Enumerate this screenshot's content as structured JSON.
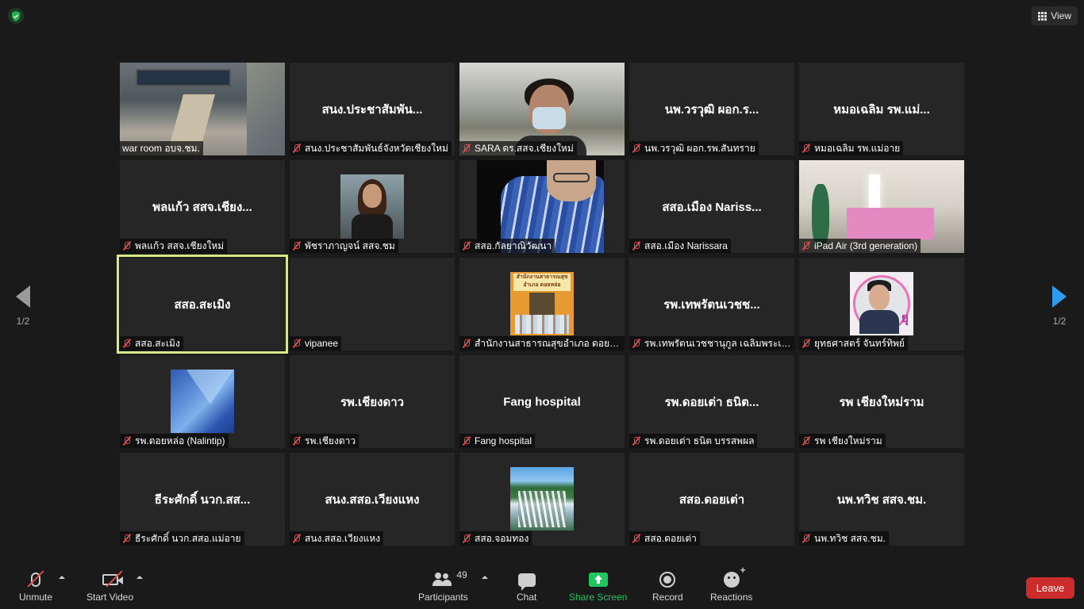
{
  "top": {
    "view_label": "View"
  },
  "pagination": {
    "left_page": "1/2",
    "right_page": "1/2"
  },
  "tiles": [
    {
      "big": "",
      "label": "war room อบจ.ชม."
    },
    {
      "big": "สนง.ประชาสัมพัน...",
      "label": "สนง.ประชาสัมพันธ์จังหวัดเชียงใหม่"
    },
    {
      "big": "",
      "label": "SARA ดร.สสจ.เชียงใหม่"
    },
    {
      "big": "นพ.วรวุฒิ ผอก.ร...",
      "label": "นพ.วรวุฒิ ผอก.รพ.สันทราย"
    },
    {
      "big": "หมอเฉลิม รพ.แม่...",
      "label": "หมอเฉลิม รพ.แม่อาย"
    },
    {
      "big": "พลแก้ว สสจ.เชียง...",
      "label": "พลแก้ว สสจ.เชียงใหม่"
    },
    {
      "big": "",
      "label": "พัชราภาญจน์ สสจ.ชม"
    },
    {
      "big": "",
      "label": "สสอ.กัลยาณิวัฒนา"
    },
    {
      "big": "สสอ.เมือง Nariss...",
      "label": "สสอ.เมือง Narissara"
    },
    {
      "big": "",
      "label": "iPad Air (3rd generation)"
    },
    {
      "big": "สสอ.สะเมิง",
      "label": "สสอ.สะเมิง"
    },
    {
      "big": "",
      "label": "vipanee"
    },
    {
      "big": "",
      "label": "สำนักงานสาธารณสุขอำเภอ ดอยหล่อ"
    },
    {
      "big": "รพ.เทพรัตนเวชช...",
      "label": "รพ.เทพรัตนเวชชานุกูล เฉลิมพระเกียรติ"
    },
    {
      "big": "",
      "label": "ยุทธศาสตร์ จันทร์ทิพย์"
    },
    {
      "big": "",
      "label": "รพ.ดอยหล่อ (Nalintip)"
    },
    {
      "big": "รพ.เชียงดาว",
      "label": "รพ.เชียงดาว"
    },
    {
      "big": "Fang hospital",
      "label": "Fang hospital"
    },
    {
      "big": "รพ.ดอยเต่า ธนิต...",
      "label": "รพ.ดอยเต่า ธนิต บรรสพผล"
    },
    {
      "big": "รพ เชียงใหม่ราม",
      "label": "รพ เชียงใหม่ราม"
    },
    {
      "big": "ธีระศักดิ์ นวก.สส...",
      "label": "ธีระศักดิ์ นวก.สสอ.แม่อาย"
    },
    {
      "big": "สนง.สสอ.เวียงแหง",
      "label": "สนง.สสอ.เวียงแหง"
    },
    {
      "big": "",
      "label": "สสอ.จอมทอง"
    },
    {
      "big": "สสอ.ดอยเต่า",
      "label": "สสอ.ดอยเต่า"
    },
    {
      "big": "นพ.ทวิช สสจ.ชม.",
      "label": "นพ.ทวิช สสจ.ชม."
    }
  ],
  "office_sign": "สำนักงานสาธารณสุข อำเภอ ดอยหล่อ",
  "avatar_text": "ยุ",
  "toolbar": {
    "unmute": "Unmute",
    "start_video": "Start Video",
    "participants": "Participants",
    "participants_count": "49",
    "chat": "Chat",
    "share_screen": "Share Screen",
    "record": "Record",
    "reactions": "Reactions",
    "leave": "Leave"
  },
  "colors": {
    "accent_share": "#22c55e",
    "leave": "#cc2c2c",
    "active_speaker": "#d9e884",
    "page_arrow": "#2d9cf0"
  }
}
